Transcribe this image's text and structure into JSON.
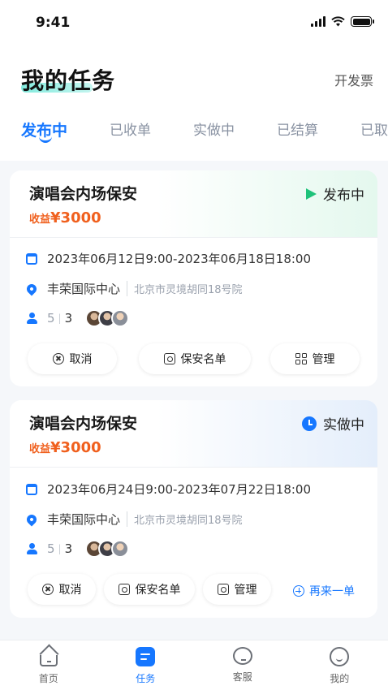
{
  "status_bar": {
    "time": "9:41"
  },
  "header": {
    "title": "我的任务",
    "invoice_label": "开发票"
  },
  "tabs": [
    {
      "label": "发布中",
      "active": true
    },
    {
      "label": "已收单",
      "active": false
    },
    {
      "label": "实做中",
      "active": false
    },
    {
      "label": "已结算",
      "active": false
    },
    {
      "label": "已取",
      "active": false
    }
  ],
  "tasks": [
    {
      "title": "演唱会内场保安",
      "income_label": "收益",
      "income_value": "¥3000",
      "status": "发布中",
      "status_color": "#1ec27a",
      "time_range": "2023年06月12日9:00-2023年06月18日18:00",
      "venue": "丰荣国际中心",
      "address": "北京市灵境胡同18号院",
      "count_total": "5",
      "count_current": "3",
      "buttons": {
        "cancel": "取消",
        "roster": "保安名单",
        "manage": "管理"
      }
    },
    {
      "title": "演唱会内场保安",
      "income_label": "收益",
      "income_value": "¥3000",
      "status": "实做中",
      "status_color": "#1677ff",
      "time_range": "2023年06月24日9:00-2023年07月22日18:00",
      "venue": "丰荣国际中心",
      "address": "北京市灵境胡同18号院",
      "count_total": "5",
      "count_current": "3",
      "buttons": {
        "cancel": "取消",
        "roster": "保安名单",
        "manage": "管理",
        "again": "再来一单"
      }
    }
  ],
  "tabbar": [
    {
      "label": "首页",
      "icon": "home-icon"
    },
    {
      "label": "任务",
      "icon": "task-icon",
      "active": true
    },
    {
      "label": "客服",
      "icon": "chat-icon"
    },
    {
      "label": "我的",
      "icon": "profile-icon"
    }
  ],
  "colors": {
    "accent": "#1677ff",
    "income": "#f0601e",
    "published": "#1ec27a"
  }
}
